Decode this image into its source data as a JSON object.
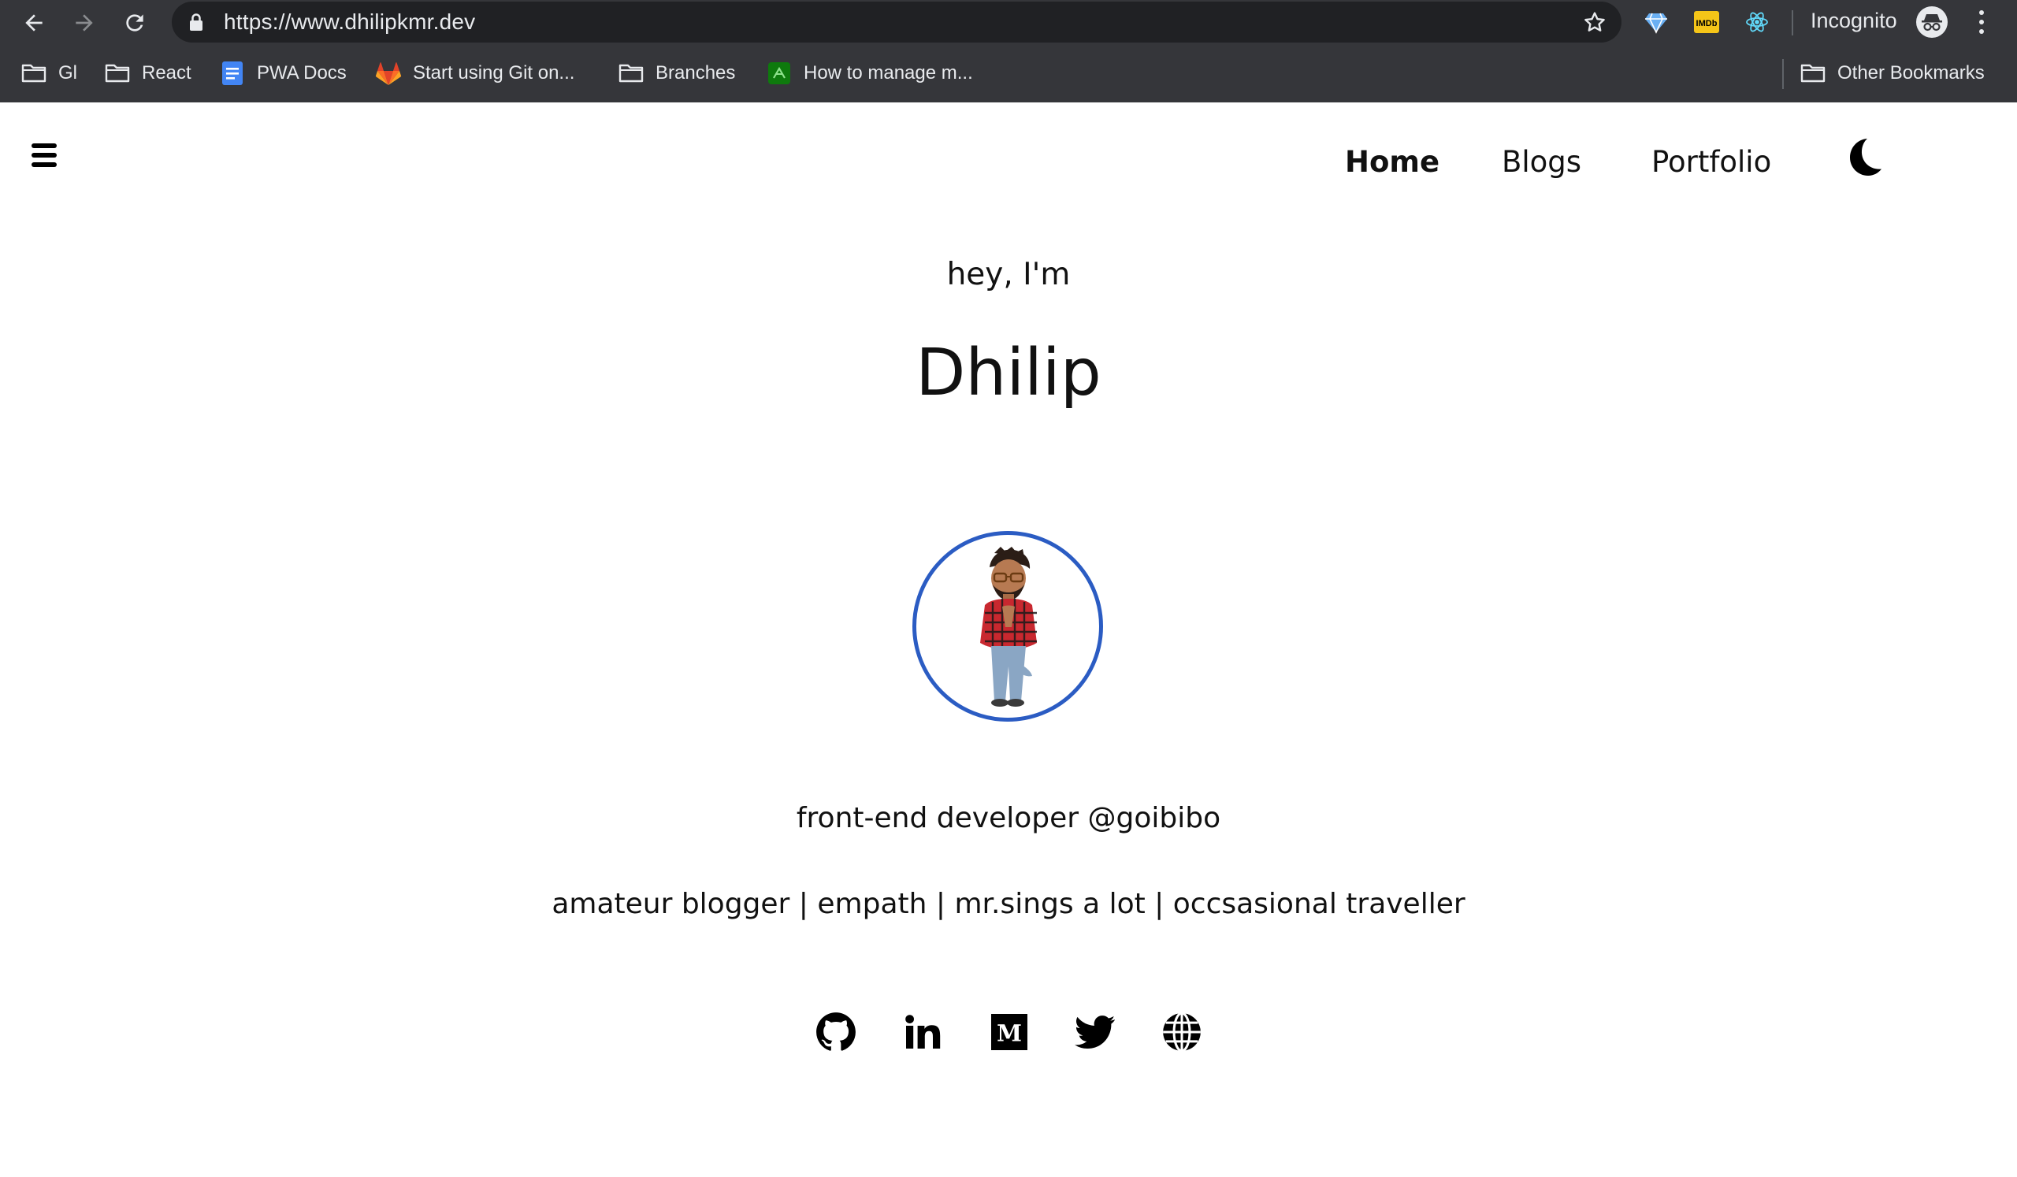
{
  "browser": {
    "url": "https://www.dhilipkmr.dev",
    "profile_label": "Incognito",
    "extensions": [
      "gem-extension-icon",
      "imdb-extension-icon",
      "react-devtools-icon"
    ],
    "imdb_badge": "IMDb"
  },
  "bookmarks": {
    "items": [
      {
        "label": "Gl",
        "icon": "folder-icon"
      },
      {
        "label": "React",
        "icon": "folder-icon"
      },
      {
        "label": "PWA Docs",
        "icon": "google-docs-icon"
      },
      {
        "label": "Start using Git on...",
        "icon": "gitlab-icon"
      },
      {
        "label": "Branches",
        "icon": "folder-icon"
      },
      {
        "label": "How to manage m...",
        "icon": "green-site-icon"
      }
    ],
    "other": "Other Bookmarks"
  },
  "nav": {
    "home": "Home",
    "blogs": "Blogs",
    "portfolio": "Portfolio",
    "theme_icon": "moon-icon"
  },
  "hero": {
    "greeting": "hey, I'm",
    "name": "Dhilip",
    "tagline": "front-end developer @goibibo",
    "bio": "amateur blogger | empath | mr.sings a lot | occsasional traveller"
  },
  "social": [
    "github-icon",
    "linkedin-icon",
    "medium-icon",
    "twitter-icon",
    "globe-icon"
  ],
  "colors": {
    "chrome_bg": "#35363a",
    "omnibox_bg": "#202124",
    "avatar_ring": "#2b5cc3",
    "text": "#111111"
  }
}
